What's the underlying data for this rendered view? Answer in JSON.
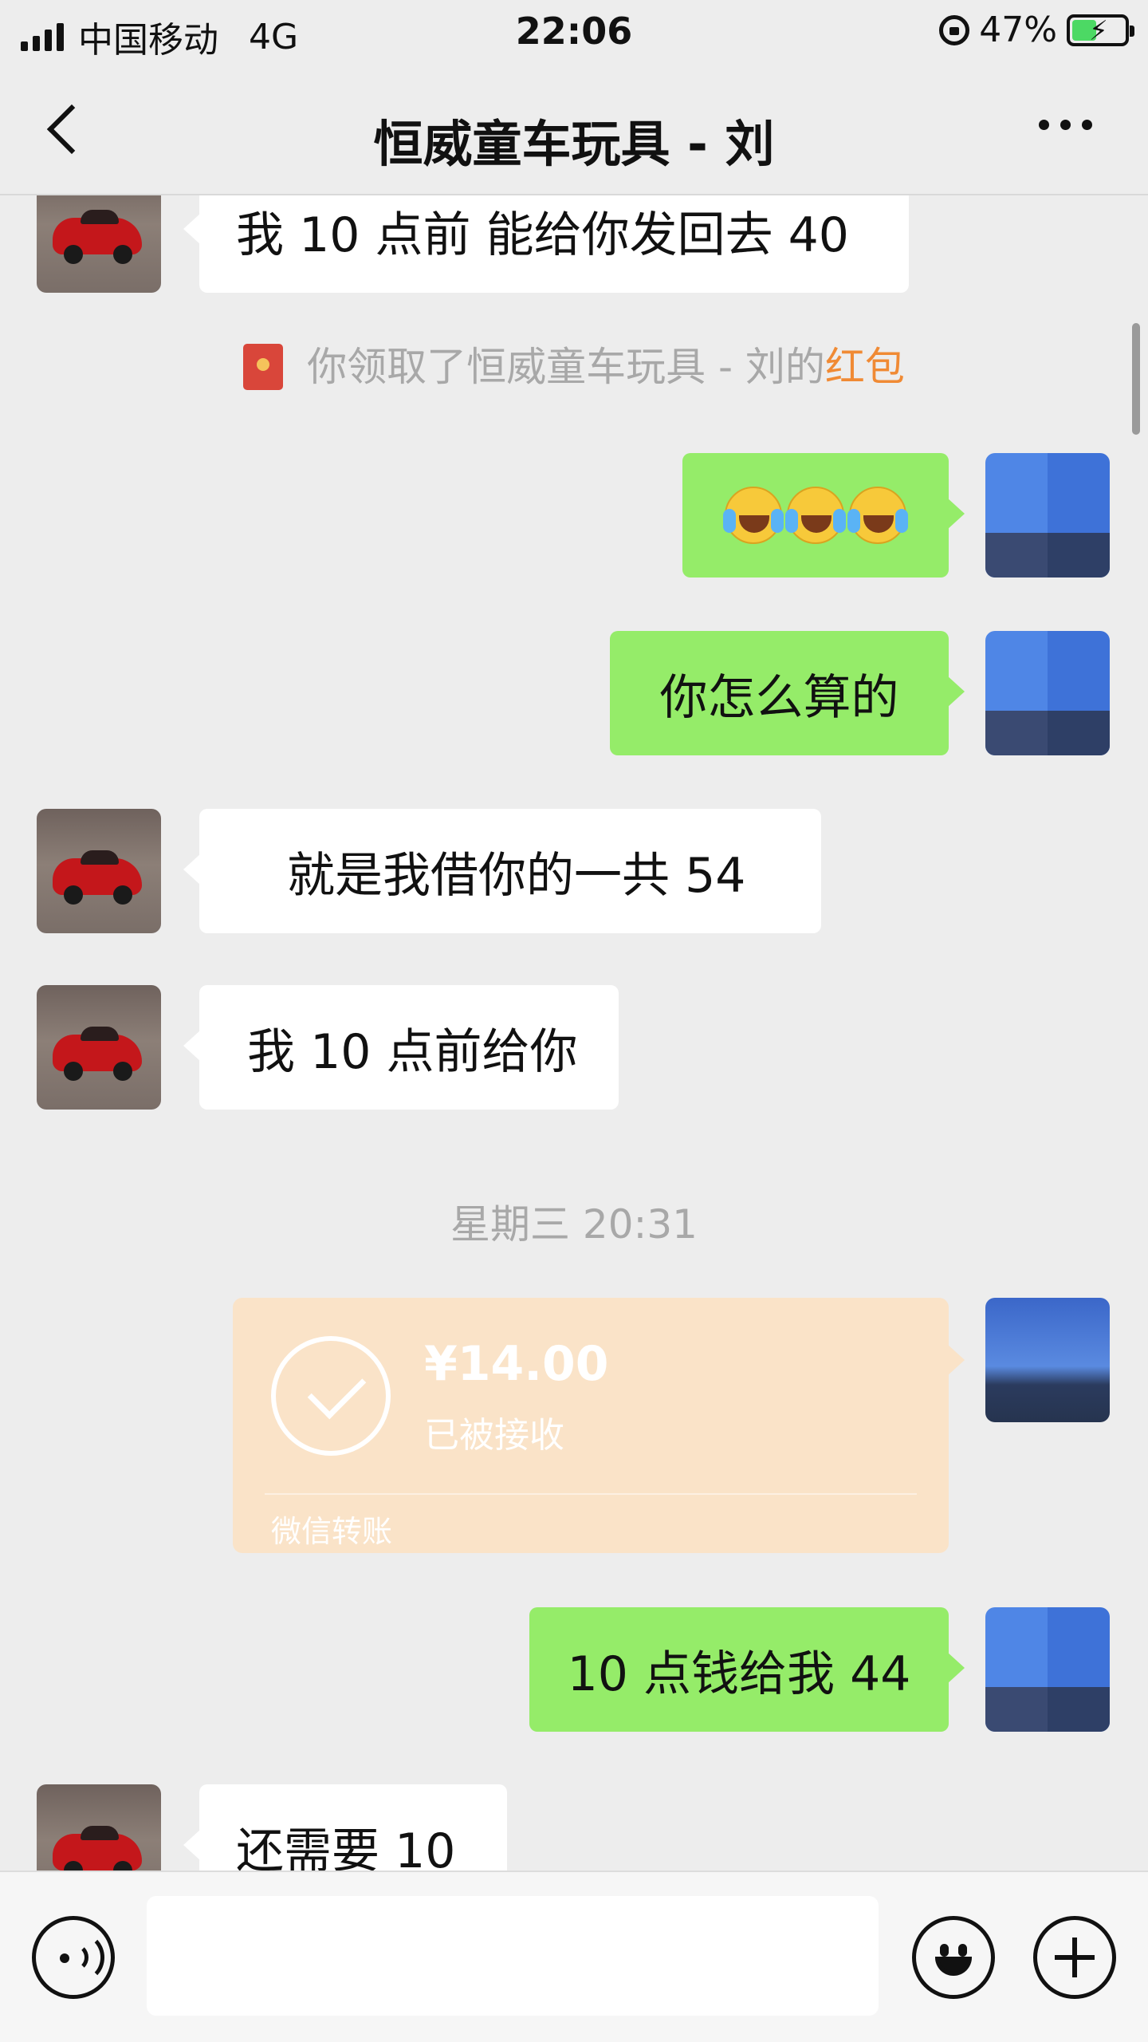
{
  "status_bar": {
    "carrier": "中国移动",
    "network": "4G",
    "time": "22:06",
    "battery_percent": "47%",
    "battery_level": 0.47
  },
  "nav": {
    "title": "恒威童车玩具 - 刘"
  },
  "messages": {
    "m1": "我 10 点前  能给你发回去 40",
    "redpacket_text": "你领取了恒威童车玩具 - 刘的",
    "redpacket_link": "红包",
    "m4": "你怎么算的",
    "m5": "就是我借你的一共 54",
    "m6": "我 10 点前给你",
    "timestamp": "星期三 20:31",
    "transfer": {
      "amount": "¥14.00",
      "status": "已被接收",
      "label": "微信转账"
    },
    "m8": "10 点钱给我 44",
    "m9": "还需要 10"
  },
  "input": {
    "placeholder": ""
  },
  "colors": {
    "background": "#ededed",
    "incoming_bubble": "#ffffff",
    "outgoing_bubble": "#95ec69",
    "transfer_card": "#fae3c8",
    "redpacket_accent": "#f08a34"
  }
}
